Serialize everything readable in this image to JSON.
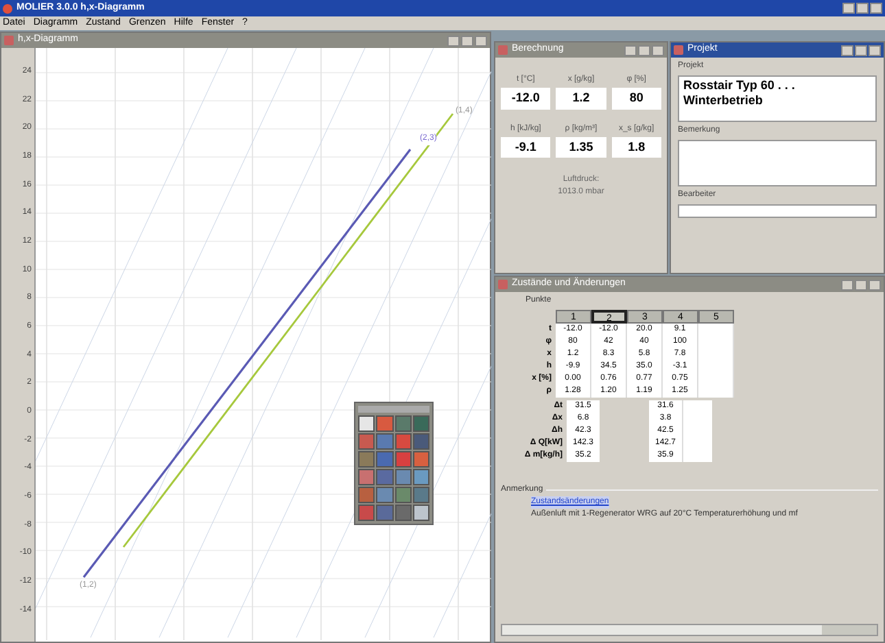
{
  "app": {
    "title": "MOLIER 3.0.0 h,x-Diagramm",
    "menu": [
      "Datei",
      "Diagramm",
      "Zustand",
      "Grenzen",
      "Hilfe",
      "Fenster",
      "?"
    ]
  },
  "diagram_window": {
    "title": "h,x-Diagramm",
    "y_axis_labels": [
      "24",
      "22",
      "20",
      "18",
      "16",
      "14",
      "12",
      "10",
      "8",
      "6",
      "4",
      "2",
      "0",
      "-2",
      "-4",
      "-6",
      "-8",
      "-10",
      "-12",
      "-14"
    ],
    "point_labels": [
      "(2,3)",
      "(1,4)",
      "(1,2)"
    ]
  },
  "calc_window": {
    "title": "Berechnung",
    "fields": [
      {
        "label": "t [°C]",
        "value": "-12.0"
      },
      {
        "label": "x [g/kg]",
        "value": "1.2"
      },
      {
        "label": "φ [%]",
        "value": "80"
      },
      {
        "label": "h [kJ/kg]",
        "value": "-9.1"
      },
      {
        "label": "ρ [kg/m³]",
        "value": "1.35"
      },
      {
        "label": "x_s [g/kg]",
        "value": "1.8"
      }
    ],
    "note": [
      "Luftdruck:",
      "1013.0 mbar"
    ]
  },
  "project_window": {
    "title": "Projekt",
    "fields": [
      {
        "label": "Projekt",
        "value": "Rosstair Typ 60 . . . Winterbetrieb"
      },
      {
        "label": "Bemerkung"
      },
      {
        "label": "Bearbeiter"
      }
    ]
  },
  "table_window": {
    "title": "Zustände und Änderungen",
    "tab": "Punkte",
    "columns": [
      {
        "label": "1",
        "selected": false
      },
      {
        "label": "2",
        "selected": true
      },
      {
        "label": "3",
        "selected": false
      },
      {
        "label": "4",
        "selected": false
      },
      {
        "label": "5",
        "selected": false
      }
    ],
    "rows": [
      {
        "label": "t",
        "cells": [
          "-12.0",
          "-12.0",
          "20.0",
          "9.1"
        ]
      },
      {
        "label": "φ",
        "cells": [
          "80",
          "42",
          "40",
          "100"
        ]
      },
      {
        "label": "x",
        "cells": [
          "1.2",
          "8.3",
          "5.8",
          "7.8"
        ]
      },
      {
        "label": "h",
        "cells": [
          "-9.9",
          "34.5",
          "35.0",
          "-3.1"
        ]
      },
      {
        "label": "x [%]",
        "cells": [
          "0.00",
          "0.76",
          "0.77",
          "0.75"
        ]
      },
      {
        "label": "ρ",
        "cells": [
          "1.28",
          "1.20",
          "1.19",
          "1.25"
        ]
      }
    ],
    "changes": [
      {
        "label": "Δt",
        "cells": [
          "31.5",
          "31.6"
        ]
      },
      {
        "label": "Δx",
        "cells": [
          "6.8",
          "3.8"
        ]
      },
      {
        "label": "Δh",
        "cells": [
          "42.3",
          "42.5"
        ]
      },
      {
        "label": "Δ Q[kW]",
        "cells": [
          "142.3",
          "142.7"
        ]
      },
      {
        "label": "Δ m[kg/h]",
        "cells": [
          "35.2",
          "35.9"
        ]
      }
    ],
    "remarks": {
      "title": "Anmerkung",
      "link": "Zustandsänderungen",
      "text": "Außenluft mit 1-Regenerator WRG auf 20°C Temperaturerhöhung und mf"
    }
  }
}
